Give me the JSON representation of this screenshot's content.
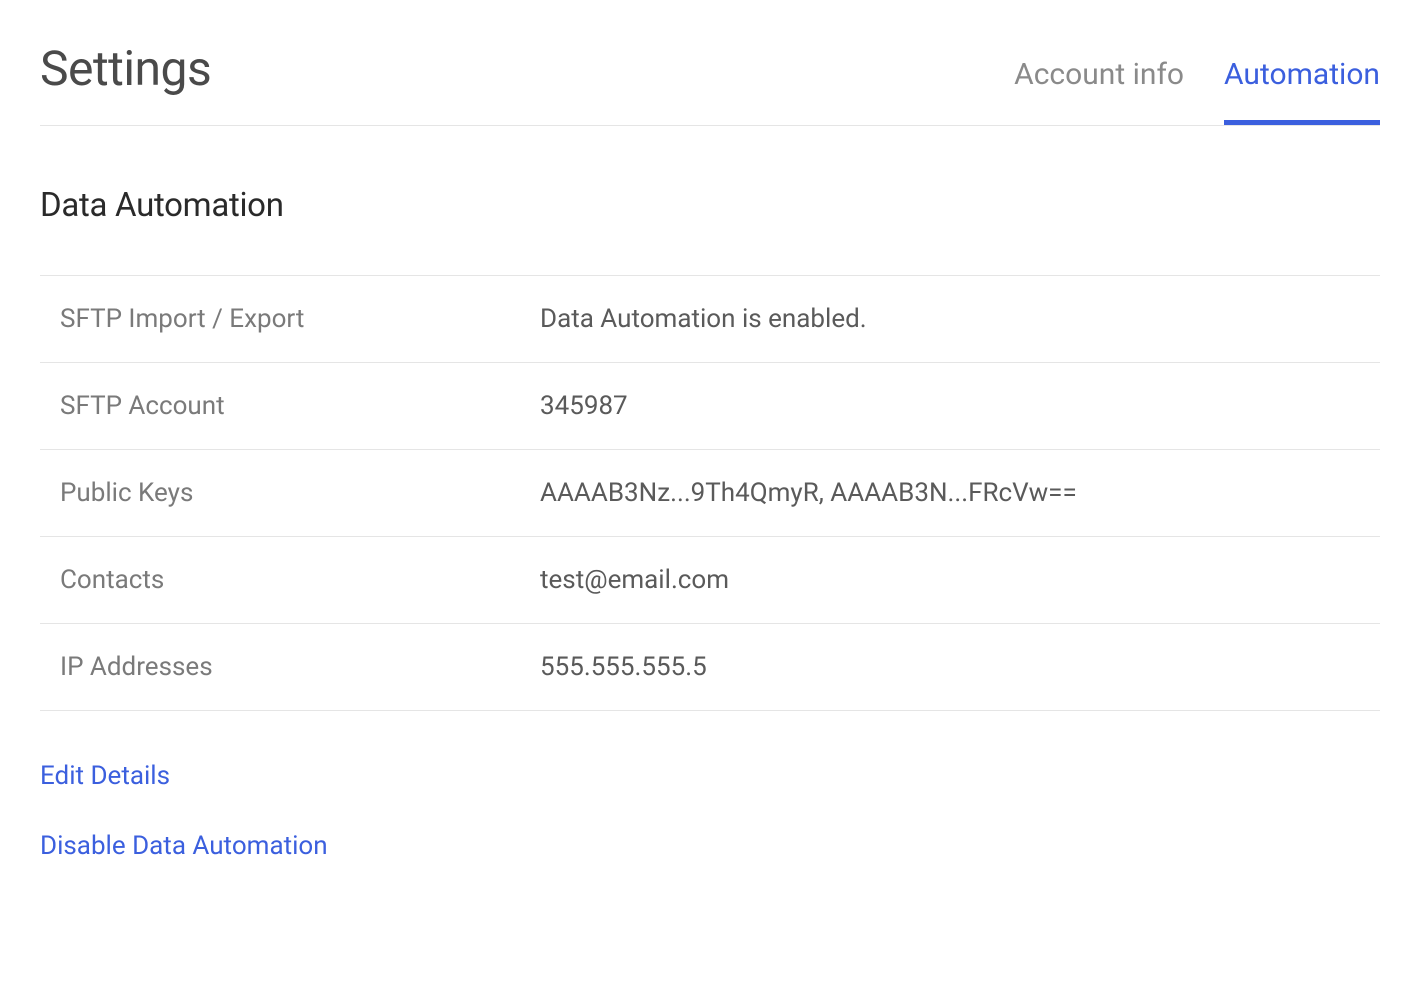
{
  "header": {
    "title": "Settings",
    "tabs": [
      {
        "label": "Account info",
        "active": false
      },
      {
        "label": "Automation",
        "active": true
      }
    ]
  },
  "section": {
    "title": "Data Automation",
    "rows": [
      {
        "label": "SFTP Import / Export",
        "value": "Data Automation is enabled."
      },
      {
        "label": "SFTP Account",
        "value": "345987"
      },
      {
        "label": "Public Keys",
        "value": "AAAAB3Nz...9Th4QmyR, AAAAB3N...FRcVw=="
      },
      {
        "label": "Contacts",
        "value": "test@email.com"
      },
      {
        "label": "IP Addresses",
        "value": "555.555.555.5"
      }
    ]
  },
  "actions": {
    "edit_label": "Edit Details",
    "disable_label": "Disable Data Automation"
  }
}
